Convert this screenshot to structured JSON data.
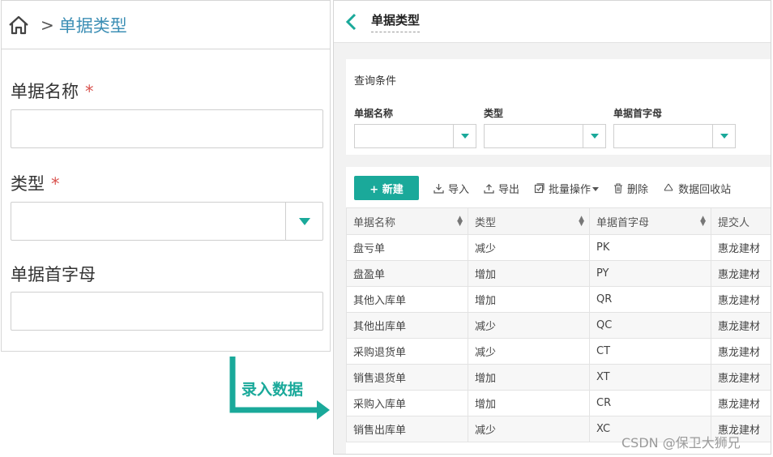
{
  "left_form": {
    "breadcrumb_sep": ">",
    "breadcrumb_title": "单据类型",
    "fields": [
      {
        "label": "单据名称",
        "required_mark": "*"
      },
      {
        "label": "类型",
        "required_mark": "*"
      },
      {
        "label": "单据首字母"
      }
    ]
  },
  "annotation": {
    "text": "录入数据",
    "color": "#1aa99a"
  },
  "right_panel": {
    "title": "单据类型",
    "query": {
      "title": "查询条件",
      "fields": [
        "单据名称",
        "类型",
        "单据首字母"
      ]
    },
    "toolbar": {
      "new_label": "+ 新建",
      "import_label": "导入",
      "export_label": "导出",
      "batch_label": "批量操作",
      "delete_label": "删除",
      "recycle_label": "数据回收站"
    },
    "table": {
      "columns": [
        "单据名称",
        "类型",
        "单据首字母",
        "提交人"
      ],
      "rows": [
        [
          "盘亏单",
          "减少",
          "PK",
          "惠龙建材"
        ],
        [
          "盘盈单",
          "增加",
          "PY",
          "惠龙建材"
        ],
        [
          "其他入库单",
          "增加",
          "QR",
          "惠龙建材"
        ],
        [
          "其他出库单",
          "减少",
          "QC",
          "惠龙建材"
        ],
        [
          "采购退货单",
          "减少",
          "CT",
          "惠龙建材"
        ],
        [
          "销售退货单",
          "增加",
          "XT",
          "惠龙建材"
        ],
        [
          "采购入库单",
          "增加",
          "CR",
          "惠龙建材"
        ],
        [
          "销售出库单",
          "减少",
          "XC",
          "惠龙建材"
        ]
      ]
    }
  },
  "watermark": "CSDN @保卫大狮兄",
  "colors": {
    "accent": "#1aa99a",
    "link": "#3d8fb5",
    "required": "#d9534f"
  }
}
